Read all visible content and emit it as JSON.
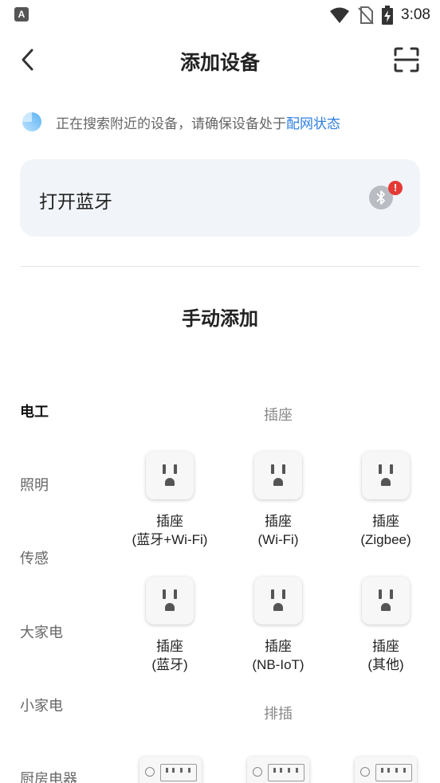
{
  "status_bar": {
    "app_badge": "A",
    "time": "3:08",
    "icons": [
      "wifi-icon",
      "no-sim-icon",
      "battery-charging-icon"
    ]
  },
  "header": {
    "title": "添加设备",
    "back_icon": "back-arrow-icon",
    "scan_icon": "scan-icon"
  },
  "search": {
    "text": "正在搜索附近的设备，请确保设备处于",
    "link": "配网状态"
  },
  "bluetooth_card": {
    "label": "打开蓝牙",
    "badge": "!"
  },
  "manual": {
    "title": "手动添加"
  },
  "categories": [
    "电工",
    "照明",
    "传感",
    "大家电",
    "小家电",
    "厨房电器"
  ],
  "active_category": "电工",
  "sections": [
    {
      "label": "插座",
      "devices": [
        {
          "line1": "插座",
          "line2": "(蓝牙+Wi-Fi)"
        },
        {
          "line1": "插座",
          "line2": "(Wi-Fi)"
        },
        {
          "line1": "插座",
          "line2": "(Zigbee)"
        },
        {
          "line1": "插座",
          "line2": "(蓝牙)"
        },
        {
          "line1": "插座",
          "line2": "(NB-IoT)"
        },
        {
          "line1": "插座",
          "line2": "(其他)"
        }
      ]
    },
    {
      "label": "排插",
      "devices": []
    }
  ],
  "colors": {
    "accent": "#2f7fe0",
    "card_bg": "#f1f4f8",
    "badge": "#e53935"
  }
}
